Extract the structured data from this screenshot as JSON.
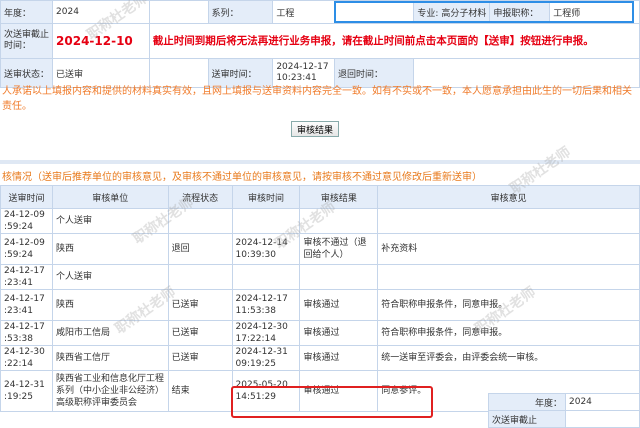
{
  "info": {
    "year_label": "年度：",
    "year_value": "2024",
    "series_label": "系列：",
    "series_value": "工程",
    "major_label": "专业:",
    "major_value": "高分子材料",
    "title_label": "申报职称：",
    "title_value": "工程师",
    "deadline_label": "次送审截止时间：",
    "deadline_value": "2024-12-10",
    "deadline_notice": "截止时间到期后将无法再进行业务申报，请在截止时间前点击本页面的【送审】按钮进行申报。",
    "status_label": "送审状态：",
    "status_value": "已送审",
    "send_time_label": "送审时间：",
    "send_time_value": "2024-12-17 10:23:41",
    "return_time_label": "退回时间：",
    "return_time_value": ""
  },
  "promise": "人承诺以上填报内容和提供的材料真实有效，且网上填报与送审资料内容完全一致。如有不实或不一致，本人愿意承担由此生的一切后果和相关责任。",
  "review_result_button": "审核结果",
  "review_heading": "核情况（送审后推荐单位的审核意见，及审核不通过单位的审核意见，请按审核不通过意见修改后重新送审）",
  "review": {
    "headers": [
      "送审时间",
      "审核单位",
      "流程状态",
      "审核时间",
      "审核结果",
      "审核意见"
    ],
    "rows": [
      {
        "send": "24-12-09 :59:24",
        "unit": "个人送审",
        "flow": "",
        "time": "",
        "result": "",
        "opinion": ""
      },
      {
        "send": "24-12-09 :59:24",
        "unit": "陕西",
        "flow": "退回",
        "time": "2024-12-14 10:39:30",
        "result": "审核不通过（退回给个人）",
        "opinion": "补充资料"
      },
      {
        "send": "24-12-17 :23:41",
        "unit": "个人送审",
        "flow": "",
        "time": "",
        "result": "",
        "opinion": ""
      },
      {
        "send": "24-12-17 :23:41",
        "unit": "陕西",
        "flow": "已送审",
        "time": "2024-12-17 11:53:38",
        "result": "审核通过",
        "opinion": "符合职称申报条件，同意申报。"
      },
      {
        "send": "24-12-17 :53:38",
        "unit": "咸阳市工信局",
        "flow": "已送审",
        "time": "2024-12-30 17:22:14",
        "result": "审核通过",
        "opinion": "符合职称申报条件，同意申报。"
      },
      {
        "send": "24-12-30 :22:14",
        "unit": "陕西省工信厅",
        "flow": "已送审",
        "time": "2024-12-31 09:19:25",
        "result": "审核通过",
        "opinion": "统一送审至评委会，由评委会统一审核。"
      },
      {
        "send": "24-12-31 :19:25",
        "unit": "陕西省工业和信息化厅工程系列（中小企业非公经济）高级职称评审委员会",
        "flow": "结束",
        "time": "2025-05-20 14:51:29",
        "result": "审核通过",
        "opinion": "同意参评。"
      }
    ]
  },
  "fragment": {
    "year_label": "年度：",
    "year_value": "2024",
    "deadline_label": "次送审截止"
  },
  "watermark": "职称杜老师"
}
